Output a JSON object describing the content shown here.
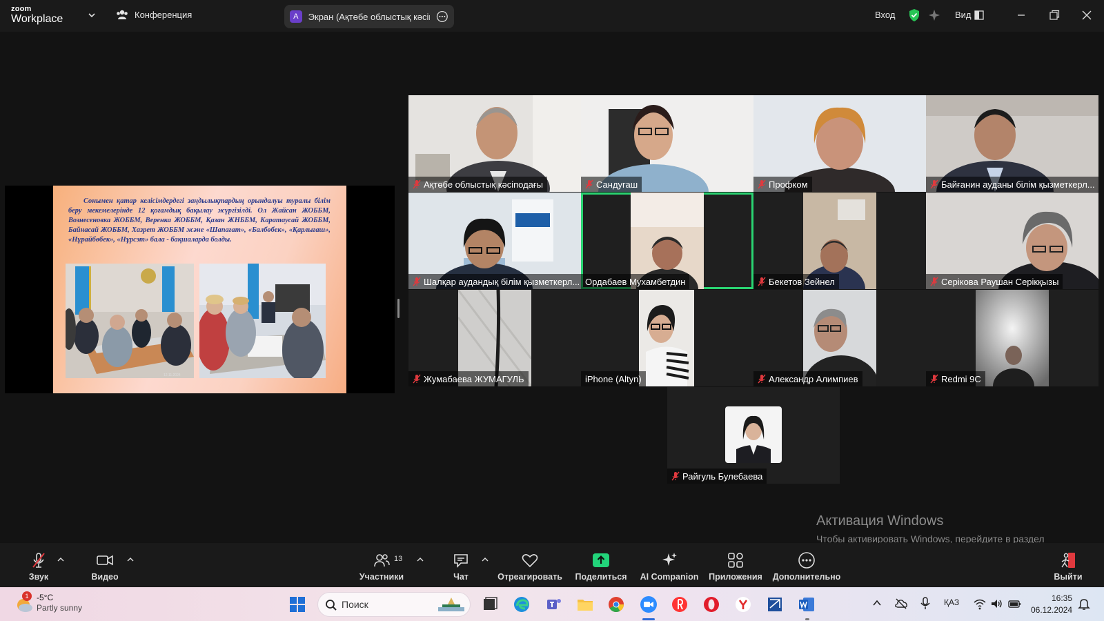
{
  "titlebar": {
    "brand_top": "zoom",
    "brand_bottom": "Workplace",
    "meeting_label": "Конференция",
    "share_avatar": "A",
    "share_label": "Экран (Ақтөбе облыстық кәсіподағы)",
    "signin_label": "Вход",
    "view_label": "Вид",
    "icons": [
      "chevron-down-icon",
      "people-icon",
      "more-circle-icon",
      "shield-check-icon",
      "sparkle-icon",
      "view-grid-icon",
      "minimize-icon",
      "restore-icon",
      "close-icon"
    ]
  },
  "slide": {
    "text": "Сонымен қатар келісімдердегі заңдылықтардың орындалуы туралы білім беру мекемелерінде 12 қоғамдық бақылау жүргізілді. Ол Жайсан ЖОББМ, Вознесеновка ЖОББМ, Веренка ЖОББМ, Қазан ЖНББМ, Каратаусай ЖОББМ, Байнасай ЖОББМ, Хазрет ЖОББМ және «Шапағат», «Балбөбек», «Қарлығаш», «Нұрайбөбек», «Нұрсэт» бала - бақшаларда болды.",
    "photo_stamp": "12.11.2024"
  },
  "participants": [
    {
      "name": "Ақтөбе облыстық кәсіподағы",
      "muted": true
    },
    {
      "name": "Сандугаш",
      "muted": true
    },
    {
      "name": "Профком",
      "muted": true
    },
    {
      "name": "Байғанин ауданы білім қызметкерл...",
      "muted": true
    },
    {
      "name": "Шалқар аудандық білім қызметкерл...",
      "muted": true
    },
    {
      "name": "Ордабаев Мухамбетдин",
      "muted": false,
      "active_speaker": true
    },
    {
      "name": "Бекетов Зейнел",
      "muted": true
    },
    {
      "name": "Серікова Раушан Серікқызы",
      "muted": true
    },
    {
      "name": "Жумабаева ЖУМАГУЛЬ",
      "muted": true
    },
    {
      "name": "iPhone (Altyn)",
      "muted": false
    },
    {
      "name": "Александр Алимпиев",
      "muted": true
    },
    {
      "name": "Redmi 9C",
      "muted": true
    },
    {
      "name": "Райгуль Булебаева",
      "muted": true
    }
  ],
  "watermark": {
    "title": "Активация Windows",
    "subtitle": "Чтобы активировать Windows, перейдите в раздел \"Параметры\"."
  },
  "toolbar": {
    "audio": "Звук",
    "video": "Видео",
    "participants": "Участники",
    "participants_count": "13",
    "chat": "Чат",
    "react": "Отреагировать",
    "share": "Поделиться",
    "ai": "AI Companion",
    "apps": "Приложения",
    "more": "Дополнительно",
    "leave": "Выйти"
  },
  "taskbar": {
    "weather_badge": "1",
    "temp": "-5°C",
    "weather": "Partly sunny",
    "search_placeholder": "Поиск",
    "lang": "ҚАЗ",
    "time": "16:35",
    "date": "06.12.2024"
  },
  "colors": {
    "active_speaker": "#2ad472",
    "muted_mic": "#e0393e",
    "share_button": "#22d47a",
    "leave_button": "#e0393e",
    "slide_text": "#2a3a8c"
  }
}
